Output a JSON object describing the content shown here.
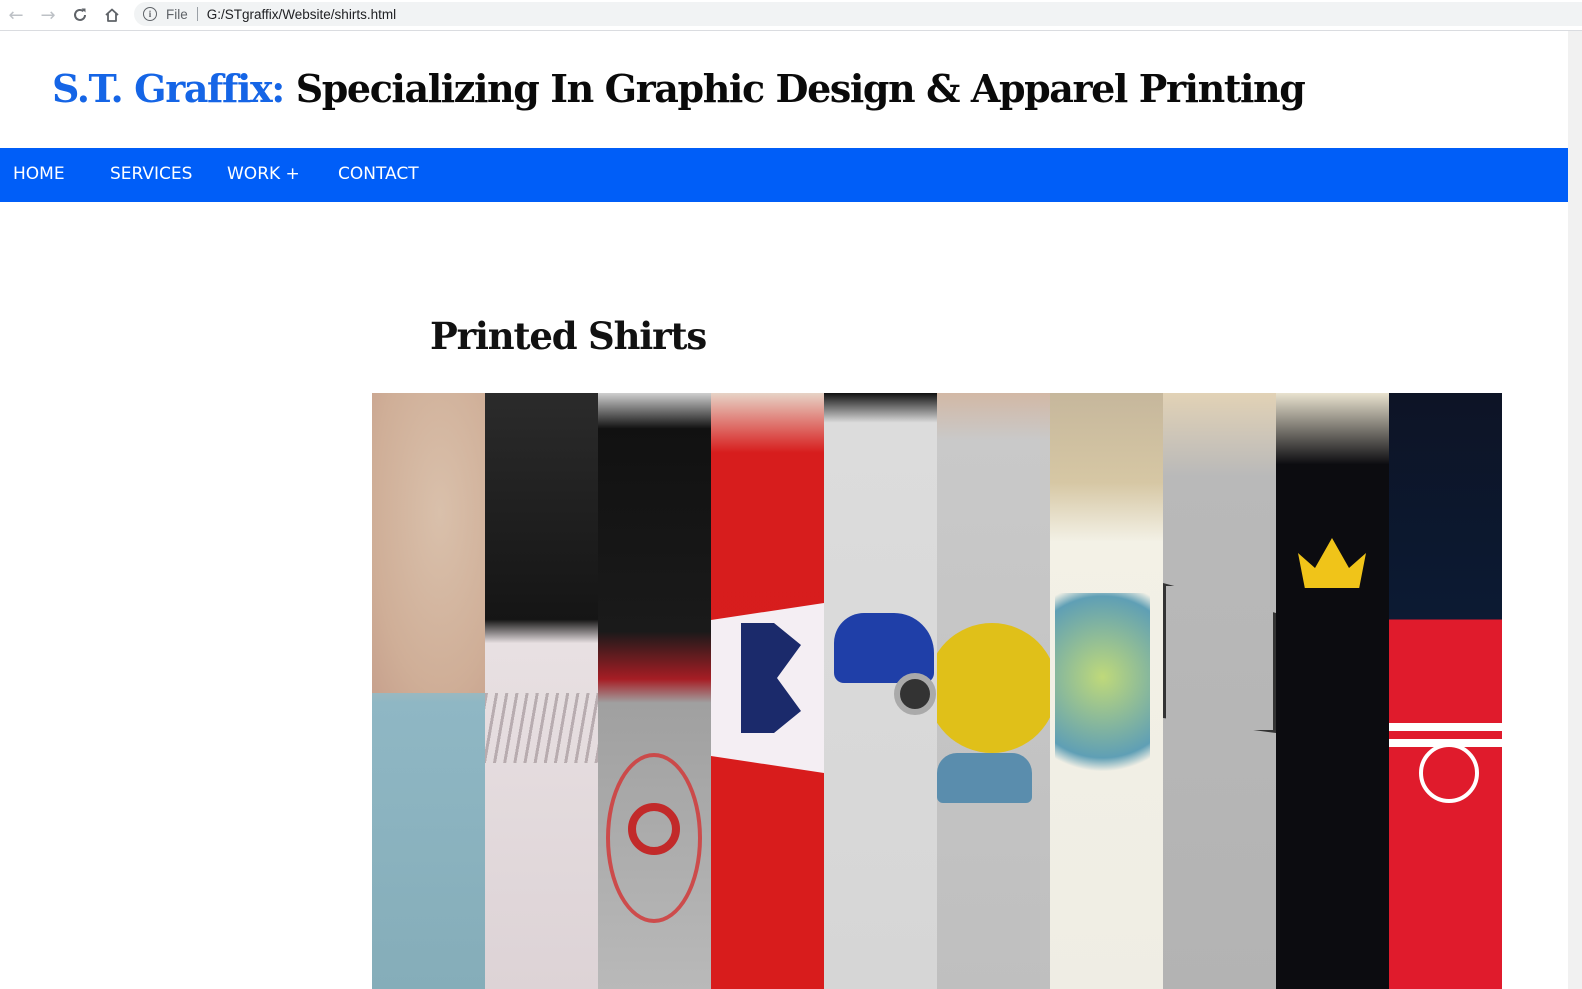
{
  "browser": {
    "file_label": "File",
    "url": "G:/STgraffix/Website/shirts.html"
  },
  "header": {
    "brand": "S.T. Graffix:",
    "tagline": " Specializing In Graphic Design & Apparel Printing"
  },
  "nav": {
    "items": [
      {
        "label": "HOME"
      },
      {
        "label": "SERVICES"
      },
      {
        "label": "WORK +"
      },
      {
        "label": "CONTACT"
      }
    ]
  },
  "main": {
    "heading": "Printed Shirts"
  },
  "colors": {
    "brand": "#1565e6",
    "nav_bg": "#005ef8"
  }
}
